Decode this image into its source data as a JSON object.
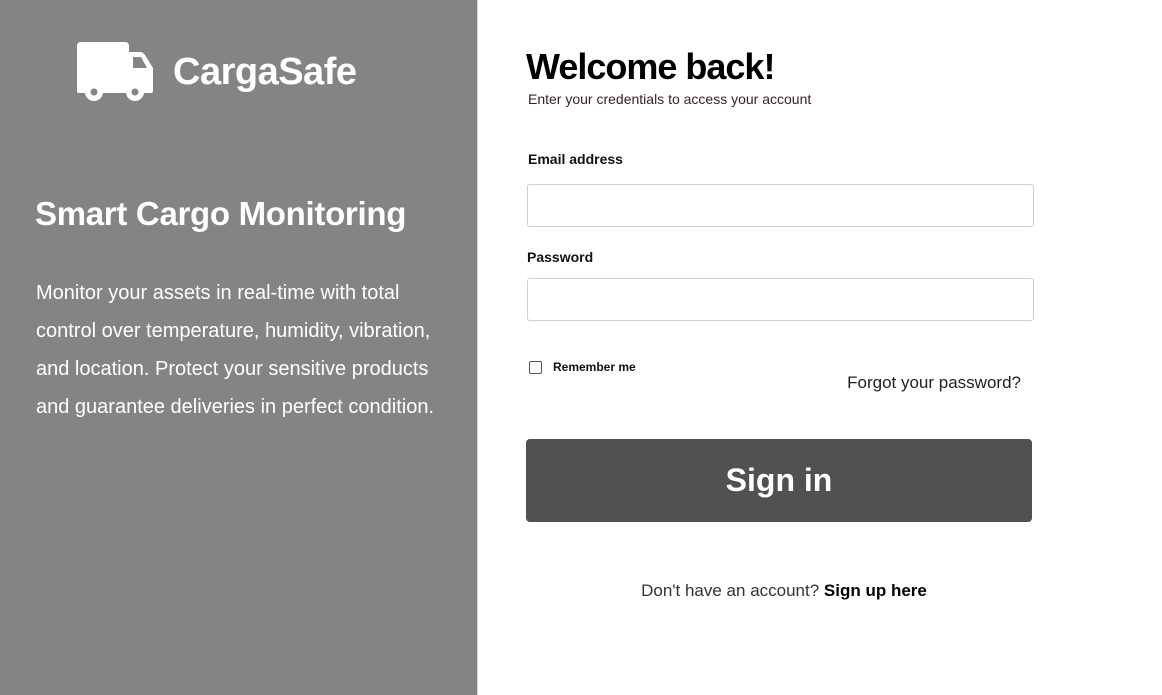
{
  "brand": {
    "name": "CargaSafe",
    "icon": "truck-icon"
  },
  "left_panel": {
    "headline": "Smart Cargo Monitoring",
    "description": "Monitor your assets in real-time with total control over temperature, humidity, vibration, and location. Protect your sensitive products and guarantee deliveries in perfect condition."
  },
  "form": {
    "title": "Welcome back!",
    "subtitle": "Enter your credentials to access your account",
    "email": {
      "label": "Email address",
      "value": "",
      "placeholder": ""
    },
    "password": {
      "label": "Password",
      "value": "",
      "placeholder": ""
    },
    "remember_label": "Remember me",
    "remember_checked": false,
    "forgot_label": "Forgot your password?",
    "submit_label": "Sign in",
    "signup_prompt": "Don't have an account?",
    "signup_link": "Sign up here"
  },
  "colors": {
    "left_panel_bg": "#848484",
    "button_bg": "#515151",
    "page_bg": "#ffffff"
  }
}
